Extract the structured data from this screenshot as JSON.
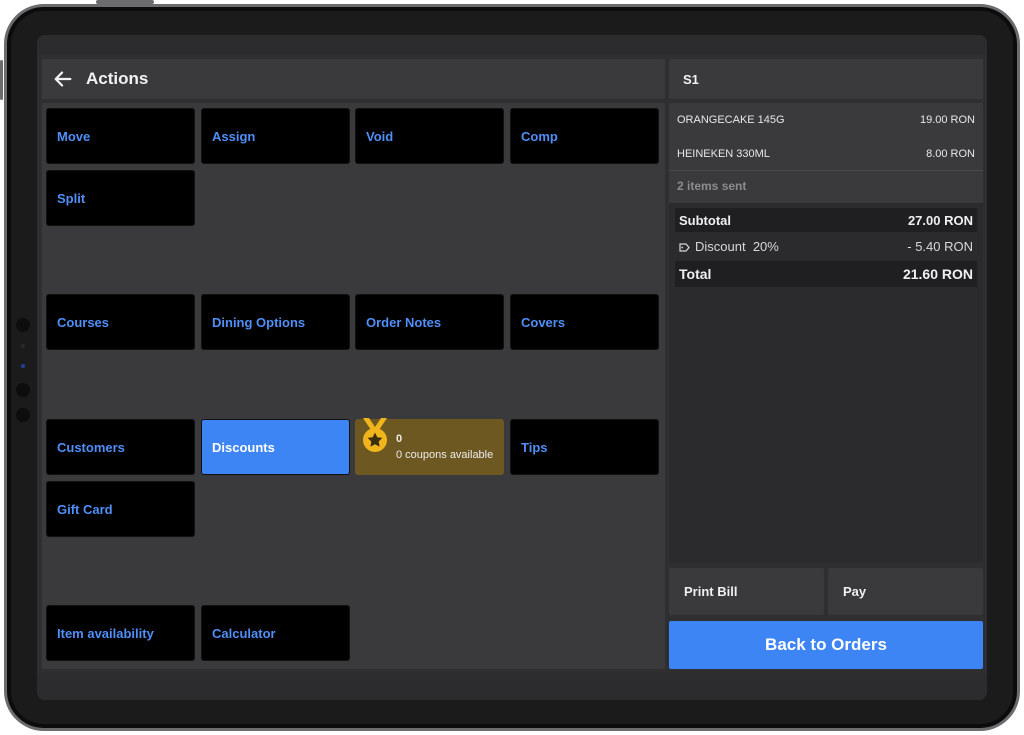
{
  "header": {
    "title": "Actions"
  },
  "actions": {
    "row1": [
      "Move",
      "Assign",
      "Void",
      "Comp"
    ],
    "row2": [
      "Split"
    ],
    "row3": [
      "Courses",
      "Dining Options",
      "Order Notes",
      "Covers"
    ],
    "row4": [
      "Customers",
      "Discounts",
      "Tips"
    ],
    "row5": [
      "Gift Card"
    ],
    "row6": [
      "Item availability",
      "Calculator"
    ]
  },
  "coupon": {
    "count": "0",
    "label": "0 coupons available"
  },
  "order": {
    "seat": "S1",
    "items": [
      {
        "name": "ORANGECAKE 145G",
        "price": "19.00 RON"
      },
      {
        "name": "HEINEKEN 330ML",
        "price": "8.00 RON"
      }
    ],
    "sent_status": "2 items sent",
    "subtotal_label": "Subtotal",
    "subtotal_value": "27.00 RON",
    "discount_label": "Discount",
    "discount_percent": "20%",
    "discount_value": "- 5.40 RON",
    "total_label": "Total",
    "total_value": "21.60 RON"
  },
  "buttons": {
    "print_bill": "Print Bill",
    "pay": "Pay",
    "back_to_orders": "Back to Orders"
  },
  "colors": {
    "accent": "#3d84f5",
    "tile_text": "#4f8ff7",
    "coupon_bg": "#6e5821",
    "medal": "#f0b51c"
  },
  "icons": [
    "back-arrow-icon",
    "medal-icon",
    "tag-icon"
  ]
}
